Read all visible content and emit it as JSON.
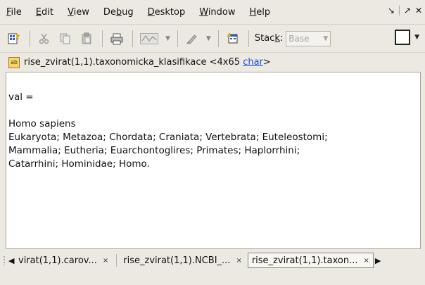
{
  "menu": {
    "file": {
      "u": "F",
      "rest": "ile"
    },
    "edit": {
      "u": "E",
      "rest": "dit"
    },
    "view": {
      "u": "V",
      "rest": "iew"
    },
    "debug": {
      "pre": "De",
      "u": "b",
      "rest": "ug"
    },
    "desktop": {
      "u": "D",
      "rest": "esktop"
    },
    "window": {
      "u": "W",
      "rest": "indow"
    },
    "help": {
      "u": "H",
      "rest": "elp"
    }
  },
  "window_controls": {
    "undock": "↘",
    "maximize": "↗",
    "close": "✕"
  },
  "toolbar": {
    "stack_label_pre": "Stac",
    "stack_label_u": "k",
    "stack_label_post": ":",
    "stack_value": "Base",
    "dropdown_arrow": "▼"
  },
  "variable": {
    "icon_text": "ab",
    "title": "rise_zvirat(1,1).taxonomicka_klasifikace",
    "size": "<4x65",
    "type_link": "char",
    "close_bracket": ">"
  },
  "content": {
    "line1": "val =",
    "line2": "Homo sapiens",
    "line3": "Eukaryota; Metazoa; Chordata; Craniata; Vertebrata; Euteleostomi;",
    "line4": "Mammalia; Eutheria; Euarchontoglires; Primates; Haplorrhini;",
    "line5": "Catarrhini; Hominidae; Homo."
  },
  "tabs": [
    {
      "label": "virat(1,1).carov...",
      "close": "×"
    },
    {
      "label": "rise_zvirat(1,1).NCBI_...",
      "close": "×"
    },
    {
      "label": "rise_zvirat(1,1).taxon...",
      "close": "×"
    }
  ],
  "tab_nav": {
    "left": "◀",
    "right": "▶"
  }
}
